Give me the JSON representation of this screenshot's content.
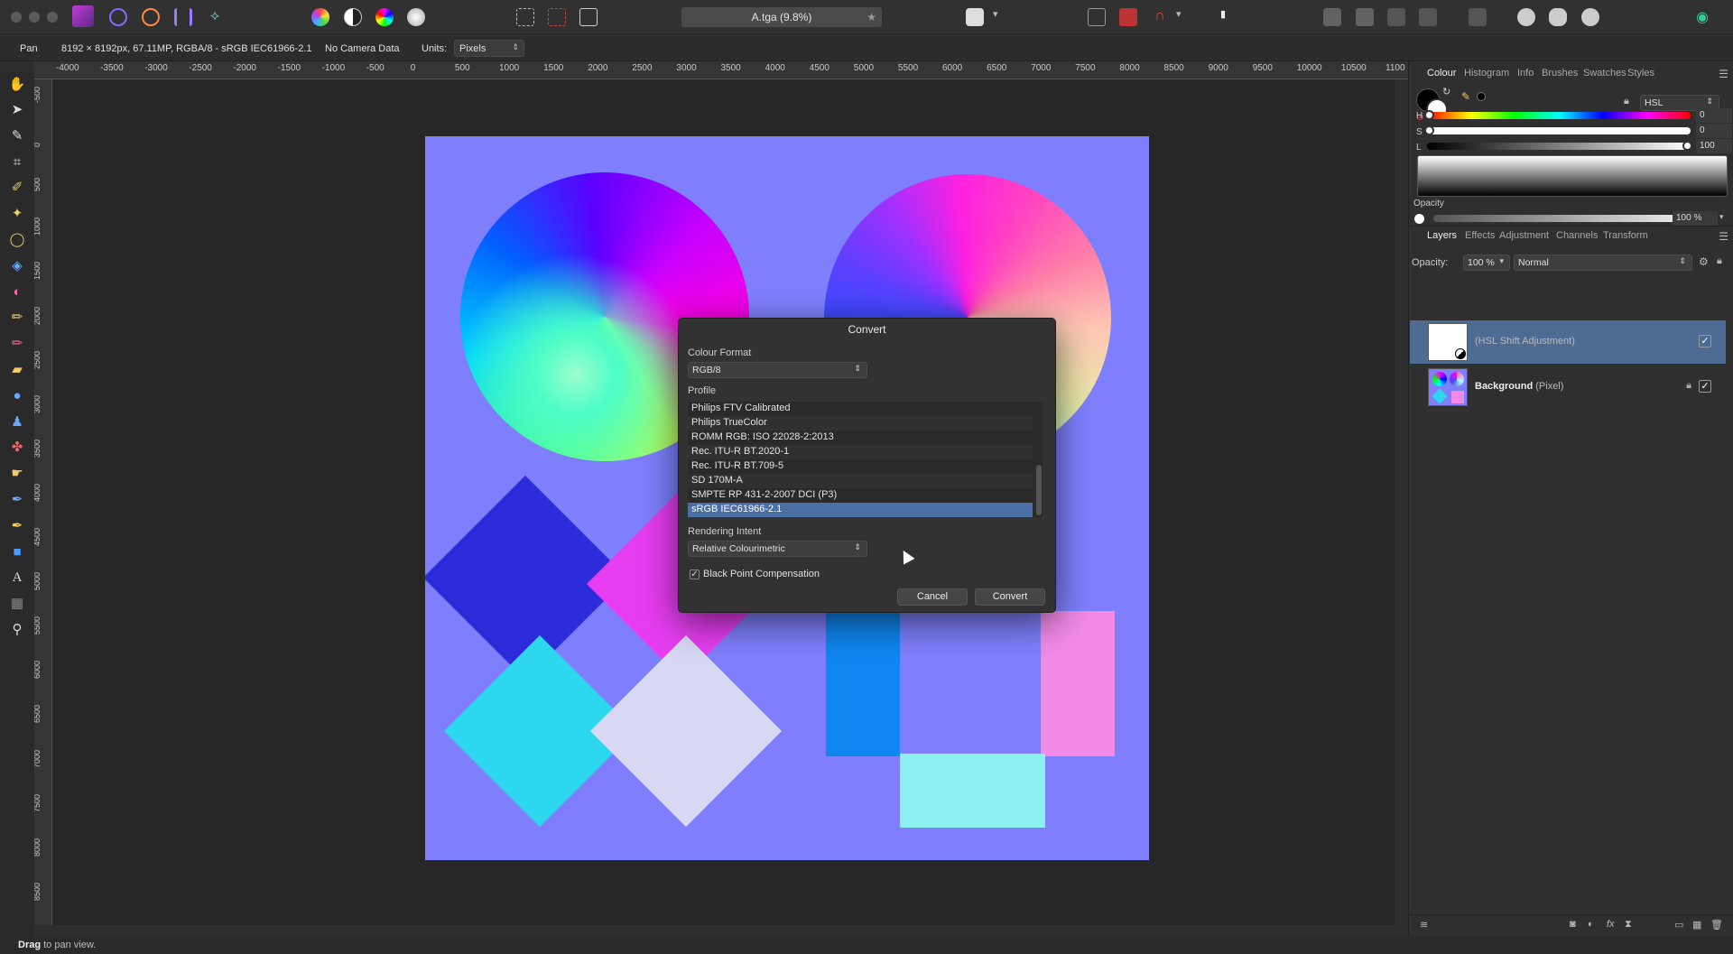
{
  "document_tab": {
    "title": "A.tga (9.8%)",
    "star": "★"
  },
  "context_bar": {
    "tool": "Pan",
    "doc_info": "8192 × 8192px, 67.11MP, RGBA/8 - sRGB IEC61966-2.1",
    "camera": "No Camera Data",
    "units_label": "Units:",
    "units_value": "Pixels"
  },
  "ruler": {
    "unit_label": "px",
    "h_ticks": [
      "-4000",
      "-3500",
      "-3000",
      "-2500",
      "-2000",
      "-1500",
      "-1000",
      "-500",
      "0",
      "500",
      "1000",
      "1500",
      "2000",
      "2500",
      "3000",
      "3500",
      "4000",
      "4500",
      "5000",
      "5500",
      "6000",
      "6500",
      "7000",
      "7500",
      "8000",
      "8500",
      "9000",
      "9500",
      "10000",
      "10500",
      "1100"
    ],
    "v_ticks": [
      "-500",
      "0",
      "500",
      "1000",
      "1500",
      "2000",
      "2500",
      "3000",
      "3500",
      "4000",
      "4500",
      "5000",
      "5500",
      "6000",
      "6500",
      "7000",
      "7500",
      "8000",
      "8500",
      "900"
    ]
  },
  "right_panel": {
    "top_tabs": [
      "Colour",
      "Histogram",
      "Info",
      "Brushes",
      "Swatches",
      "Styles"
    ],
    "colour_model": "HSL",
    "sliders": [
      {
        "label": "H",
        "value": "0"
      },
      {
        "label": "S",
        "value": "0"
      },
      {
        "label": "L",
        "value": "100"
      }
    ],
    "opacity_label": "Opacity",
    "opacity_value": "100 %",
    "layer_tabs": [
      "Layers",
      "Effects",
      "Adjustment",
      "Channels",
      "Transform"
    ],
    "layers_opacity_label": "Opacity:",
    "layers_opacity_value": "100 %",
    "blend_mode": "Normal",
    "layers": [
      {
        "name": "(HSL Shift Adjustment)",
        "type": "",
        "selected": true
      },
      {
        "name": "Background",
        "type": "(Pixel)",
        "selected": false
      }
    ]
  },
  "dialog": {
    "title": "Convert",
    "colour_format_label": "Colour Format",
    "colour_format_value": "RGB/8",
    "profile_label": "Profile",
    "profiles": [
      "Philips FTV Calibrated",
      "Philips TrueColor",
      "ROMM RGB: ISO 22028-2:2013",
      "Rec. ITU-R BT.2020-1",
      "Rec. ITU-R BT.709-5",
      "SD 170M-A",
      "SMPTE RP 431-2-2007 DCI (P3)",
      "sRGB IEC61966-2.1"
    ],
    "selected_profile_index": 7,
    "rendering_intent_label": "Rendering Intent",
    "rendering_intent_value": "Relative Colourimetric",
    "black_point_label": "Black Point Compensation",
    "black_point_checked": true,
    "cancel_label": "Cancel",
    "convert_label": "Convert"
  },
  "status": {
    "bold": "Drag",
    "text": "to pan view."
  }
}
